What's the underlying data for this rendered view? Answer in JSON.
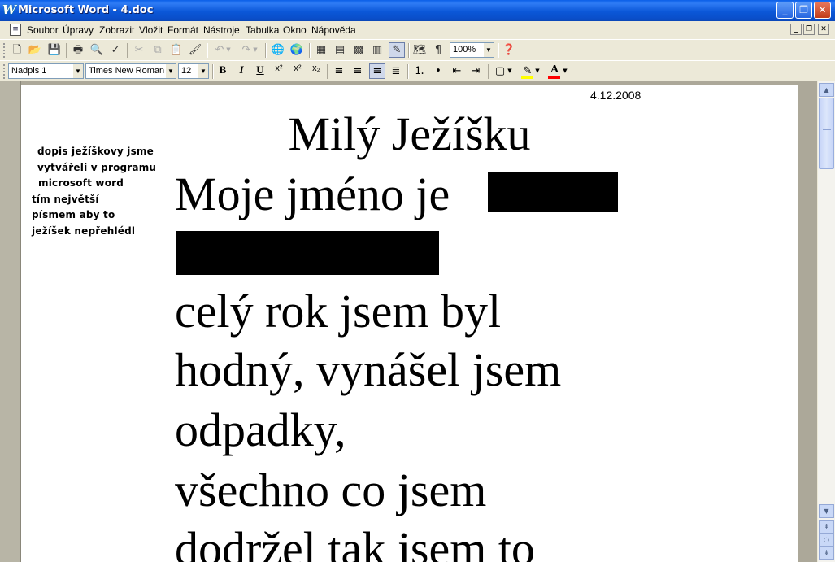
{
  "window": {
    "app_icon": "W",
    "title": "Microsoft Word - 4.doc",
    "buttons": {
      "minimize": "_",
      "restore": "❐",
      "close": "✕"
    }
  },
  "menu": {
    "items": [
      "Soubor",
      "Úpravy",
      "Zobrazit",
      "Vložit",
      "Formát",
      "Nástroje",
      "Tabulka",
      "Okno",
      "Nápověda"
    ],
    "doc_buttons": {
      "minimize": "_",
      "restore": "❐",
      "close": "✕"
    }
  },
  "toolbar_standard": {
    "zoom": "100%",
    "icons": [
      "new-document-icon",
      "open-folder-icon",
      "save-icon",
      "print-icon",
      "print-preview-icon",
      "spelling-icon",
      "cut-icon",
      "copy-icon",
      "paste-icon",
      "format-painter-icon",
      "undo-icon",
      "redo-icon",
      "hyperlink-icon",
      "web-toolbar-icon",
      "tables-borders-icon",
      "insert-table-icon",
      "insert-excel-icon",
      "columns-icon",
      "drawing-icon",
      "document-map-icon",
      "show-formatting-icon",
      "help-icon"
    ]
  },
  "toolbar_formatting": {
    "style": "Nadpis 1",
    "font": "Times New Roman",
    "size": "12",
    "bold": "B",
    "italic": "I",
    "underline": "U",
    "superscript": "x²",
    "superscript2": "x²",
    "subscript": "x₂",
    "font_color_letter": "A",
    "colors": {
      "highlight": "#ffff00",
      "font_color": "#ff0000"
    }
  },
  "document": {
    "date": "4.12.2008",
    "heading": "Milý Ježíšku",
    "lines": [
      "Moje jméno je",
      "celý rok jsem byl",
      "hodný, vynášel jsem",
      "odpadky,",
      "všechno co jsem",
      "dodržel tak jsem to"
    ],
    "side_note": [
      "dopis ježíškovy jsme",
      "vytvářeli v programu",
      "microsoft word",
      "tím největší",
      "písmem aby to",
      "ježíšek nepřehlédl"
    ]
  }
}
